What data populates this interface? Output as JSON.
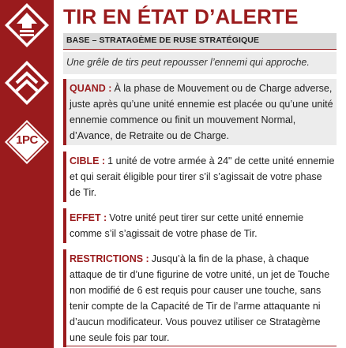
{
  "card": {
    "title": "TIR EN ÉTAT D’ALERTE",
    "category": "BASE – STRATAGÈME DE RUSE STRATÉGIQUE",
    "flavor": "Une grêle de tirs peut repousser l’ennemi qui approche.",
    "cost": "1PC",
    "icons": [
      "up-arrow-icon",
      "chevrons-up-icon"
    ],
    "accent_color": "#9a1b1d",
    "rules": [
      {
        "label": "QUAND :",
        "text": "À la phase de Mouvement ou de Charge adverse, juste après qu’une unité ennemie est placée ou qu’une unité ennemie commence ou finit un mouvement Normal, d’Avance, de Retraite ou de Charge."
      },
      {
        "label": "CIBLE :",
        "text": "1 unité de votre armée à 24\" de cette unité ennemie et qui serait éligible pour tirer s’il s’agissait de votre phase de Tir."
      },
      {
        "label": "EFFET :",
        "text": "Votre unité peut tirer sur cette unité ennemie comme s’il s’agissait de votre phase de Tir."
      },
      {
        "label": "RESTRICTIONS :",
        "text": "Jusqu’à la fin de la phase, à chaque attaque de tir d’une figurine de votre unité, un jet de Touche non modifié de 6 est requis pour causer une touche, sans tenir compte de la Capacité de Tir de l’arme attaquante ni d’aucun modificateur. Vous pouvez utiliser ce Stratagème une seule fois par tour."
      }
    ]
  }
}
